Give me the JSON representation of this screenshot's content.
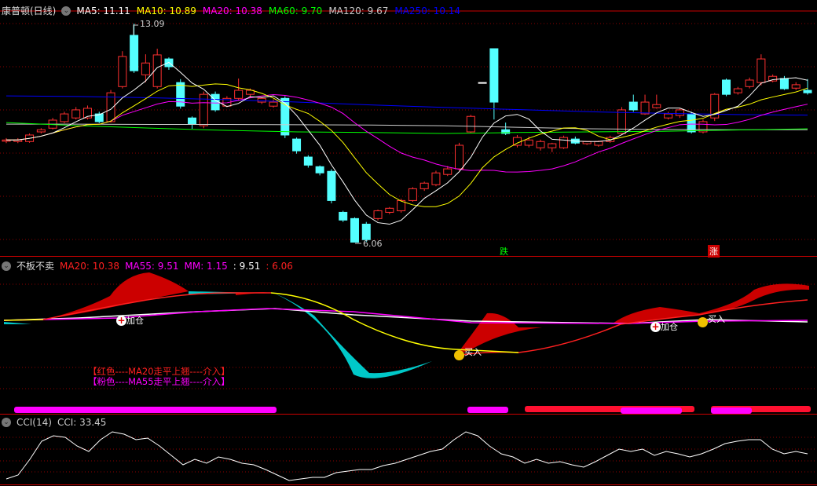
{
  "main": {
    "title": "康普顿(日线)",
    "ma": [
      {
        "label": "MA5: 11.11",
        "color": "#ffffff"
      },
      {
        "label": "MA10: 10.89",
        "color": "#ffff00"
      },
      {
        "label": "MA20: 10.38",
        "color": "#ff00ff"
      },
      {
        "label": "MA60: 9.70",
        "color": "#00ff00"
      },
      {
        "label": "MA120: 9.67",
        "color": "#cccccc"
      },
      {
        "label": "MA250: 10.14",
        "color": "#0000ff"
      }
    ],
    "high_label": "13.09",
    "low_label": "6.06",
    "fall_label": "跌",
    "rise_label": "涨",
    "price_max": 13.09,
    "price_min": 6.06,
    "candles": [
      [
        9.3,
        9.34,
        9.4,
        9.24
      ],
      [
        9.29,
        9.34,
        9.4,
        9.24
      ],
      [
        9.29,
        9.5,
        9.55,
        9.25
      ],
      [
        9.6,
        9.67,
        9.72,
        9.55
      ],
      [
        9.72,
        9.98,
        10.05,
        9.68
      ],
      [
        9.93,
        10.18,
        10.25,
        9.88
      ],
      [
        10.05,
        10.31,
        10.4,
        10.0
      ],
      [
        10.05,
        10.36,
        10.45,
        10.0
      ],
      [
        10.18,
        9.93,
        10.25,
        9.88
      ],
      [
        9.93,
        10.86,
        10.95,
        9.9
      ],
      [
        11.06,
        12.03,
        12.2,
        11.0
      ],
      [
        12.71,
        11.57,
        13.09,
        11.5
      ],
      [
        11.44,
        11.82,
        12.1,
        11.2
      ],
      [
        11.06,
        12.08,
        12.28,
        11.0
      ],
      [
        11.95,
        11.7,
        12.0,
        11.6
      ],
      [
        11.19,
        10.43,
        11.3,
        10.35
      ],
      [
        10.05,
        9.85,
        10.1,
        9.7
      ],
      [
        9.8,
        10.81,
        10.9,
        9.72
      ],
      [
        10.81,
        10.31,
        10.9,
        10.25
      ],
      [
        10.43,
        10.68,
        10.75,
        10.4
      ],
      [
        10.68,
        10.94,
        11.32,
        10.6
      ],
      [
        10.81,
        10.94,
        11.0,
        10.7
      ],
      [
        10.56,
        10.68,
        10.72,
        10.5
      ],
      [
        10.43,
        10.56,
        10.65,
        10.38
      ],
      [
        10.68,
        9.5,
        10.75,
        9.4
      ],
      [
        9.37,
        8.99,
        9.42,
        8.9
      ],
      [
        8.79,
        8.53,
        8.85,
        8.45
      ],
      [
        8.48,
        8.28,
        8.52,
        8.2
      ],
      [
        8.33,
        7.39,
        8.4,
        7.3
      ],
      [
        7.01,
        6.76,
        7.06,
        6.7
      ],
      [
        6.81,
        6.05,
        6.85,
        6.05
      ],
      [
        6.63,
        6.13,
        6.7,
        6.06
      ],
      [
        6.81,
        7.06,
        7.1,
        6.75
      ],
      [
        7.01,
        7.14,
        7.18,
        6.95
      ],
      [
        7.06,
        7.39,
        7.45,
        7.0
      ],
      [
        7.39,
        7.77,
        7.82,
        7.35
      ],
      [
        7.77,
        7.95,
        8.0,
        7.7
      ],
      [
        7.9,
        8.28,
        8.35,
        7.85
      ],
      [
        8.23,
        8.41,
        8.5,
        8.18
      ],
      [
        8.41,
        9.17,
        9.25,
        8.35
      ],
      [
        9.6,
        10.1,
        10.15,
        9.55
      ],
      [
        11.19,
        11.19,
        11.19,
        11.19
      ],
      [
        12.28,
        10.56,
        12.28,
        10.0
      ],
      [
        9.67,
        9.55,
        9.9,
        9.5
      ],
      [
        9.17,
        9.42,
        9.5,
        9.1
      ],
      [
        9.17,
        9.34,
        9.45,
        9.1
      ],
      [
        9.09,
        9.29,
        9.35,
        9.0
      ],
      [
        9.09,
        9.22,
        9.25,
        8.95
      ],
      [
        9.09,
        9.42,
        9.48,
        9.05
      ],
      [
        9.37,
        9.24,
        9.45,
        9.2
      ],
      [
        9.22,
        9.29,
        9.3,
        9.18
      ],
      [
        9.17,
        9.29,
        9.32,
        9.12
      ],
      [
        9.29,
        9.42,
        9.48,
        9.25
      ],
      [
        9.55,
        10.31,
        10.4,
        9.5
      ],
      [
        10.56,
        10.31,
        10.8,
        10.25
      ],
      [
        10.18,
        10.56,
        10.8,
        10.15
      ],
      [
        10.38,
        10.48,
        10.8,
        10.35
      ],
      [
        10.05,
        10.18,
        10.25,
        10.0
      ],
      [
        10.13,
        10.31,
        10.35,
        10.05
      ],
      [
        10.18,
        9.6,
        10.25,
        9.55
      ],
      [
        9.6,
        9.93,
        10.0,
        9.55
      ],
      [
        10.05,
        10.81,
        10.85,
        9.95
      ],
      [
        11.27,
        10.81,
        11.32,
        10.75
      ],
      [
        10.86,
        10.99,
        11.05,
        10.8
      ],
      [
        11.06,
        11.27,
        11.35,
        11.0
      ],
      [
        11.19,
        11.95,
        12.1,
        11.1
      ],
      [
        11.24,
        11.39,
        11.45,
        11.2
      ],
      [
        11.32,
        10.99,
        11.4,
        10.95
      ],
      [
        11.01,
        11.12,
        11.2,
        10.95
      ],
      [
        10.94,
        10.86,
        11.3,
        10.8
      ]
    ],
    "ma60": [
      9.9,
      9.8,
      9.72,
      9.65,
      9.6,
      9.58,
      9.55,
      9.58,
      9.6,
      9.62,
      9.66,
      9.7
    ],
    "ma120": [
      9.85,
      9.85,
      9.84,
      9.84,
      9.83,
      9.82,
      9.8,
      9.75,
      9.7,
      9.68,
      9.67,
      9.67
    ],
    "ma250": [
      10.76,
      10.74,
      10.7,
      10.64,
      10.56,
      10.47,
      10.39,
      10.32,
      10.25,
      10.2,
      10.16,
      10.14
    ]
  },
  "indicator": {
    "title": "不板不卖",
    "items": [
      {
        "label": "MA20: 10.38",
        "color": "#ff2020"
      },
      {
        "label": "MA55: 9.51",
        "color": "#ff00ff"
      },
      {
        "label": "MM: 1.15",
        "color": "#ff00ff"
      },
      {
        "label": ": 9.51",
        "color": "#ffffff"
      },
      {
        "label": ": 6.06",
        "color": "#ff2020"
      }
    ],
    "signals": {
      "add1": "加仓",
      "add2": "加仓",
      "buy1": "买入",
      "buy2": "买入"
    },
    "note1": "【红色----MA20走平上翘----介入】",
    "note2": "【粉色----MA55走平上翘----介入】",
    "note1_color": "#ff2020",
    "note2_color": "#ff00ff"
  },
  "cci": {
    "title": "CCI(14)",
    "value_label": "CCI: 33.45",
    "values": [
      -95,
      -75,
      5,
      97,
      125,
      117,
      73,
      45,
      105,
      145,
      133,
      105,
      113,
      73,
      25,
      -23,
      5,
      -15,
      17,
      5,
      -15,
      -23,
      -47,
      -75,
      -103,
      -95,
      -87,
      -87,
      -63,
      -55,
      -47,
      -47,
      -27,
      -15,
      5,
      25,
      45,
      57,
      105,
      145,
      125,
      73,
      33,
      17,
      -15,
      5,
      -15,
      -7,
      -23,
      -35,
      -7,
      25,
      57,
      45,
      57,
      25,
      45,
      33,
      17,
      33,
      57,
      85,
      97,
      105,
      105,
      57,
      33,
      45,
      33
    ]
  }
}
